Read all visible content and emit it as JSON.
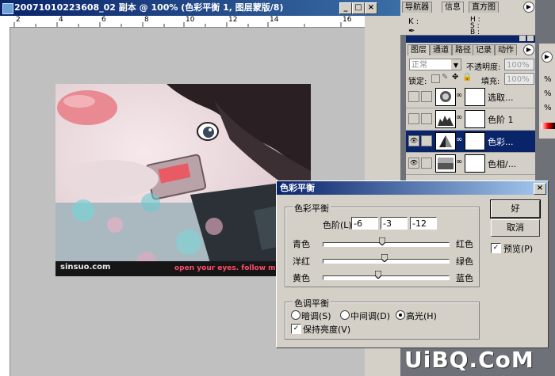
{
  "document": {
    "title": "20071010223608_02 副本 @ 100% (色彩平衡 1, 图层蒙版/8)",
    "minimize": "_",
    "maximize": "□",
    "close": "×",
    "ruler_numbers": [
      "2",
      "4",
      "6",
      "8",
      "10",
      "12",
      "14",
      "16"
    ],
    "photo_text": {
      "site": "sinsuo.com",
      "caption": "open your eyes. follow me."
    }
  },
  "navigator_panel": {
    "tabs": [
      "导航器",
      "信息",
      "直方图"
    ],
    "k_label": "K :",
    "h_label": "H :",
    "s_label": "S :",
    "b_label": "B :"
  },
  "layers_panel": {
    "tabs": [
      "图层",
      "通道",
      "路径",
      "记录",
      "动作"
    ],
    "blend_mode": "正常",
    "opacity_label": "不透明度:",
    "opacity_value": "100%",
    "lock_label": "锁定:",
    "fill_label": "填充:",
    "fill_value": "100%",
    "layers": [
      {
        "name": "选取...",
        "visible": false,
        "selected": false
      },
      {
        "name": "色阶 1",
        "visible": false,
        "selected": false
      },
      {
        "name": "色彩...",
        "visible": true,
        "selected": true
      },
      {
        "name": "色相/...",
        "visible": true,
        "selected": false
      }
    ]
  },
  "dialog": {
    "title": "色彩平衡",
    "close": "×",
    "color_balance_group": "色彩平衡",
    "levels_label": "色阶(L):",
    "levels": [
      "-6",
      "-3",
      "-12"
    ],
    "sliders": [
      {
        "left": "青色",
        "right": "红色",
        "value": -6
      },
      {
        "left": "洋红",
        "right": "绿色",
        "value": -3
      },
      {
        "left": "黄色",
        "right": "蓝色",
        "value": -12
      }
    ],
    "tone_group": "色调平衡",
    "tones": [
      {
        "label": "暗调(S)",
        "selected": false
      },
      {
        "label": "中间调(D)",
        "selected": false
      },
      {
        "label": "高光(H)",
        "selected": true
      }
    ],
    "preserve_label": "保持亮度(V)",
    "preserve_checked": true,
    "ok_label": "好",
    "cancel_label": "取消",
    "preview_label": "预览(P)",
    "preview_checked": true
  },
  "right_edge_fragments": [
    "%",
    "%",
    "%"
  ],
  "watermark": "UiBQ.CoM"
}
